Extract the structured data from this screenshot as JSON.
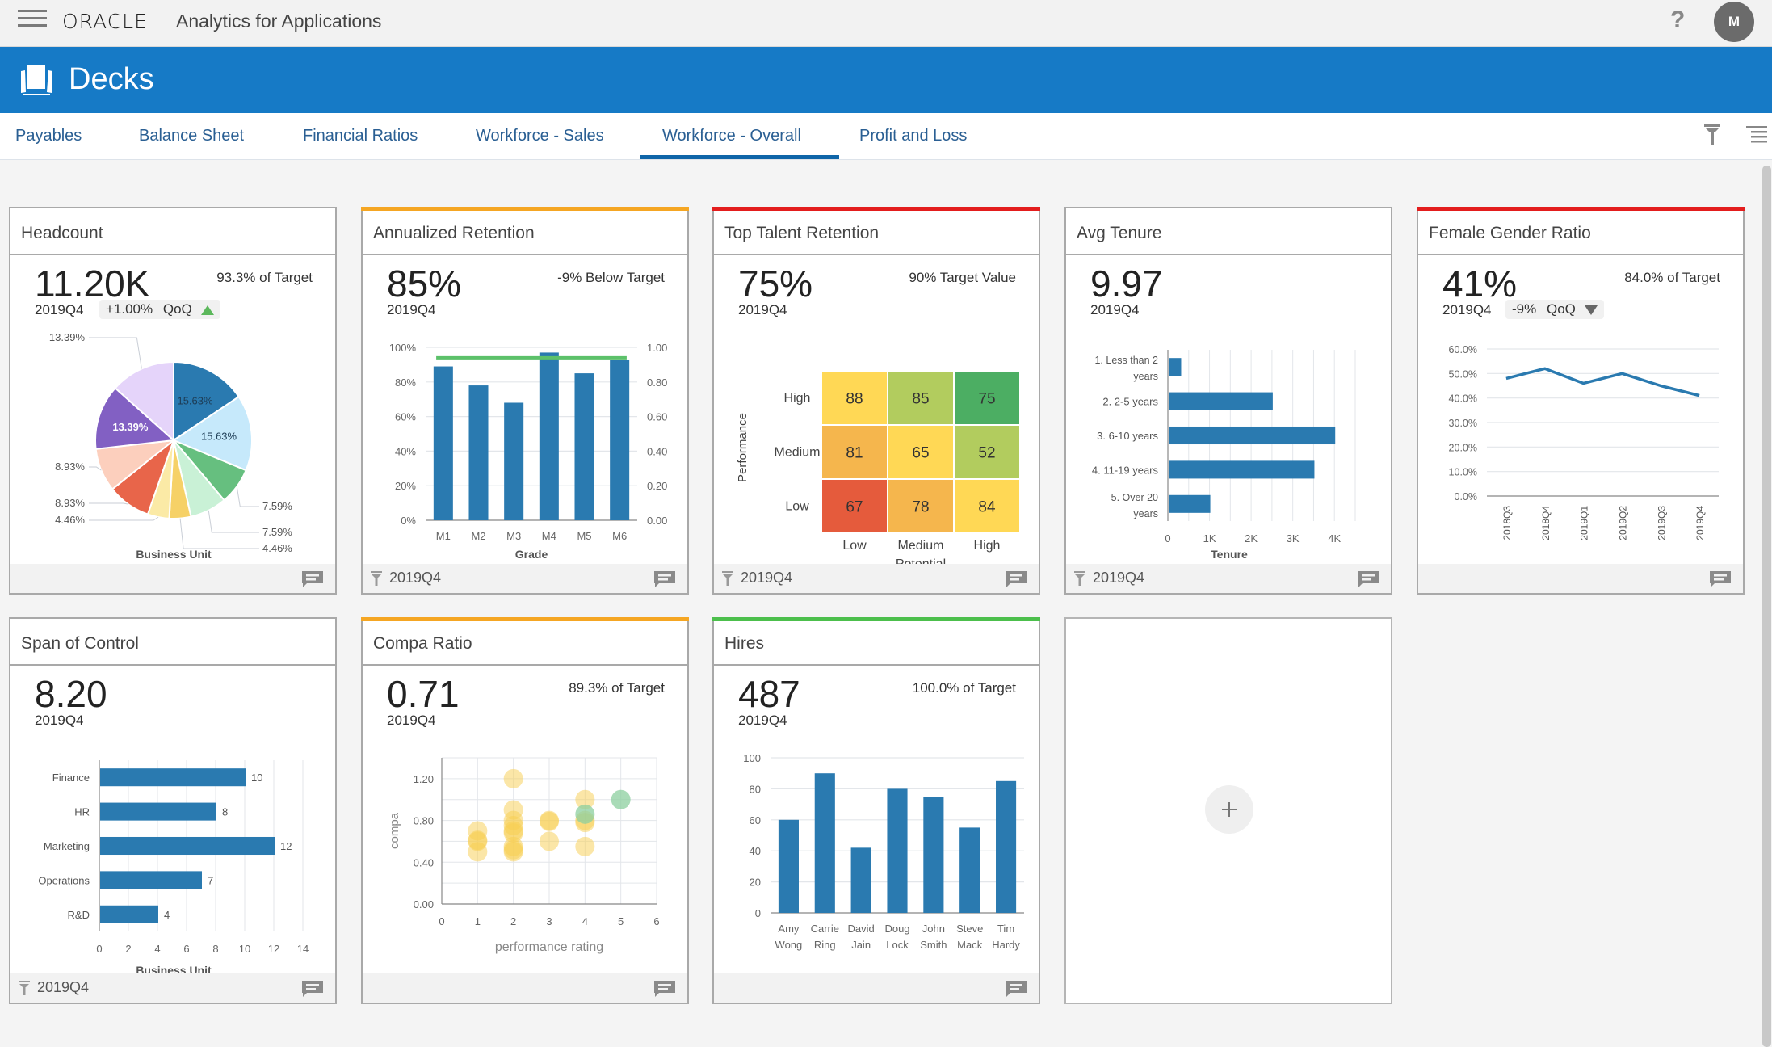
{
  "topbar": {
    "brand": "ORACLE",
    "app_name": "Analytics for Applications",
    "help_label": "?",
    "avatar_initial": "M"
  },
  "banner": {
    "title": "Decks"
  },
  "tabs": [
    {
      "label": "Payables",
      "active": false
    },
    {
      "label": "Balance Sheet",
      "active": false
    },
    {
      "label": "Financial Ratios",
      "active": false
    },
    {
      "label": "Workforce - Sales",
      "active": false
    },
    {
      "label": "Workforce - Overall",
      "active": true
    },
    {
      "label": "Profit and Loss",
      "active": false
    }
  ],
  "colors": {
    "brand_blue": "#167ac6",
    "bar_blue": "#2a7ab0",
    "accent_orange": "#f5a623",
    "accent_red": "#e31d1d",
    "accent_green": "#4cbf4c",
    "target_line": "#5cc16a"
  },
  "cards": {
    "headcount": {
      "title": "Headcount",
      "kpi": "11.20K",
      "period": "2019Q4",
      "target": "93.3% of Target",
      "qoq": {
        "change": "+1.00%",
        "label": "QoQ",
        "direction": "up"
      },
      "footer_period": ""
    },
    "annualized_retention": {
      "title": "Annualized Retention",
      "kpi": "85%",
      "period": "2019Q4",
      "target": "-9% Below Target",
      "accent": "orange",
      "footer_period": "2019Q4"
    },
    "top_talent_retention": {
      "title": "Top Talent Retention",
      "kpi": "75%",
      "period": "2019Q4",
      "target": "90% Target Value",
      "accent": "red",
      "footer_period": "2019Q4"
    },
    "avg_tenure": {
      "title": "Avg Tenure",
      "kpi": "9.97",
      "period": "2019Q4",
      "target": "",
      "footer_period": "2019Q4"
    },
    "female_gender_ratio": {
      "title": "Female Gender Ratio",
      "kpi": "41%",
      "period": "2019Q4",
      "target": "84.0% of Target",
      "qoq": {
        "change": "-9%",
        "label": "QoQ",
        "direction": "down"
      },
      "accent": "red",
      "footer_period": ""
    },
    "span_of_control": {
      "title": "Span of Control",
      "kpi": "8.20",
      "period": "2019Q4",
      "target": "",
      "footer_period": "2019Q4"
    },
    "compa_ratio": {
      "title": "Compa Ratio",
      "kpi": "0.71",
      "period": "2019Q4",
      "target": "89.3% of Target",
      "accent": "orange",
      "footer_period": ""
    },
    "hires": {
      "title": "Hires",
      "kpi": "487",
      "period": "2019Q4",
      "target": "100.0% of Target",
      "accent": "green",
      "footer_period": ""
    },
    "add_card": {
      "icon": "plus-icon"
    }
  },
  "chart_data": [
    {
      "id": "headcount",
      "type": "pie",
      "xlabel": "Business Unit",
      "slices": [
        {
          "value": 15.63,
          "label": "15.63%",
          "color": "#2a7ab0",
          "label_inside": true
        },
        {
          "value": 15.63,
          "label": "15.63%",
          "color": "#c6e9fb",
          "label_inside": true
        },
        {
          "value": 7.59,
          "label": "7.59%",
          "color": "#66bf7f",
          "label_inside": false
        },
        {
          "value": 7.59,
          "label": "7.59%",
          "color": "#c9f1d6",
          "label_inside": false
        },
        {
          "value": 4.46,
          "label": "4.46%",
          "color": "#f6d167",
          "label_inside": false
        },
        {
          "value": 4.46,
          "label": "4.46%",
          "color": "#fbeaa6",
          "label_inside": false
        },
        {
          "value": 8.93,
          "label": "8.93%",
          "color": "#e8654a",
          "label_inside": false
        },
        {
          "value": 8.93,
          "label": "8.93%",
          "color": "#fccfbd",
          "label_inside": false
        },
        {
          "value": 13.39,
          "label": "13.39%",
          "color": "#8260c3",
          "label_inside": true
        },
        {
          "value": 13.39,
          "label": "13.39%",
          "color": "#e5d4fa",
          "label_inside": false
        }
      ]
    },
    {
      "id": "annualized_retention",
      "type": "bar",
      "categories": [
        "M1",
        "M2",
        "M3",
        "M4",
        "M5",
        "M6"
      ],
      "values": [
        89,
        78,
        68,
        97,
        85,
        93
      ],
      "target_line": 94,
      "xlabel": "Grade",
      "ylim": [
        0,
        100
      ],
      "yticks": [
        "0%",
        "20%",
        "40%",
        "60%",
        "80%",
        "100%"
      ],
      "y2ticks": [
        "0.00",
        "0.20",
        "0.40",
        "0.60",
        "0.80",
        "1.00"
      ]
    },
    {
      "id": "top_talent_retention",
      "type": "heatmap",
      "ylabel": "Performance",
      "xlabel": "Potential",
      "rows": [
        "High",
        "Medium",
        "Low"
      ],
      "cols": [
        "Low",
        "Medium",
        "High"
      ],
      "values": [
        [
          88,
          85,
          75
        ],
        [
          81,
          65,
          52
        ],
        [
          67,
          78,
          84
        ]
      ],
      "cell_colors": [
        [
          "#ffd855",
          "#b2cc5e",
          "#4cae63"
        ],
        [
          "#f5b64d",
          "#ffd855",
          "#b2cc5e"
        ],
        [
          "#e55b3c",
          "#f5b64d",
          "#ffd855"
        ]
      ]
    },
    {
      "id": "avg_tenure",
      "type": "bar",
      "orientation": "horizontal",
      "categories": [
        "1. Less than 2 years",
        "2. 2-5 years",
        "3. 6-10 years",
        "4. 11-19 years",
        "5. Over 20 years"
      ],
      "values": [
        300,
        2500,
        4000,
        3500,
        1000
      ],
      "xlabel": "Tenure",
      "xlim": [
        0,
        4500
      ],
      "xticks": [
        "0",
        "1K",
        "2K",
        "3K",
        "4K"
      ]
    },
    {
      "id": "female_gender_ratio",
      "type": "line",
      "categories": [
        "2018Q3",
        "2018Q4",
        "2019Q1",
        "2019Q2",
        "2019Q3",
        "2019Q4"
      ],
      "values": [
        48,
        52,
        46,
        50,
        45,
        41
      ],
      "ylim": [
        0,
        60
      ],
      "yticks": [
        "0.0%",
        "10.0%",
        "20.0%",
        "30.0%",
        "40.0%",
        "50.0%",
        "60.0%"
      ]
    },
    {
      "id": "span_of_control",
      "type": "bar",
      "orientation": "horizontal",
      "categories": [
        "Finance",
        "HR",
        "Marketing",
        "Operations",
        "R&D"
      ],
      "values": [
        10,
        8,
        12,
        7,
        4
      ],
      "xlabel": "Business Unit",
      "xlim": [
        0,
        14
      ],
      "xticks": [
        "0",
        "2",
        "4",
        "6",
        "8",
        "10",
        "12",
        "14"
      ]
    },
    {
      "id": "compa_ratio",
      "type": "scatter",
      "xlabel": "performance rating",
      "ylabel": "compa",
      "xlim": [
        0,
        6
      ],
      "ylim": [
        0,
        1.4
      ],
      "xticks": [
        "0",
        "1",
        "2",
        "3",
        "4",
        "5",
        "6"
      ],
      "yticks": [
        "0.00",
        "0.40",
        "0.80",
        "1.20"
      ],
      "points": [
        {
          "x": 1,
          "y": 0.7,
          "group": "yellow"
        },
        {
          "x": 1,
          "y": 0.6,
          "group": "yellow"
        },
        {
          "x": 1,
          "y": 0.61,
          "group": "yellow"
        },
        {
          "x": 1,
          "y": 0.5,
          "group": "yellow"
        },
        {
          "x": 2,
          "y": 1.2,
          "group": "yellow"
        },
        {
          "x": 2,
          "y": 0.9,
          "group": "yellow"
        },
        {
          "x": 2,
          "y": 0.8,
          "group": "yellow"
        },
        {
          "x": 2,
          "y": 0.75,
          "group": "yellow"
        },
        {
          "x": 2,
          "y": 0.7,
          "group": "yellow"
        },
        {
          "x": 2,
          "y": 0.68,
          "group": "yellow"
        },
        {
          "x": 2,
          "y": 0.55,
          "group": "yellow"
        },
        {
          "x": 2,
          "y": 0.52,
          "group": "yellow"
        },
        {
          "x": 2,
          "y": 0.5,
          "group": "yellow"
        },
        {
          "x": 3,
          "y": 0.8,
          "group": "yellow"
        },
        {
          "x": 3,
          "y": 0.79,
          "group": "yellow"
        },
        {
          "x": 3,
          "y": 0.6,
          "group": "yellow"
        },
        {
          "x": 4,
          "y": 1.0,
          "group": "yellow"
        },
        {
          "x": 4,
          "y": 0.8,
          "group": "yellow"
        },
        {
          "x": 4,
          "y": 0.78,
          "group": "yellow"
        },
        {
          "x": 4,
          "y": 0.55,
          "group": "yellow"
        },
        {
          "x": 4,
          "y": 0.86,
          "group": "green"
        },
        {
          "x": 5,
          "y": 1.0,
          "group": "green"
        }
      ]
    },
    {
      "id": "hires",
      "type": "bar",
      "categories": [
        "Amy Wong",
        "Carrie Ring",
        "David Jain",
        "Doug Lock",
        "John Smith",
        "Steve Mack",
        "Tim Hardy"
      ],
      "values": [
        60,
        90,
        42,
        80,
        75,
        55,
        85
      ],
      "xlabel": "Manager",
      "ylim": [
        0,
        100
      ],
      "yticks": [
        "0",
        "20",
        "40",
        "60",
        "80",
        "100"
      ]
    }
  ]
}
